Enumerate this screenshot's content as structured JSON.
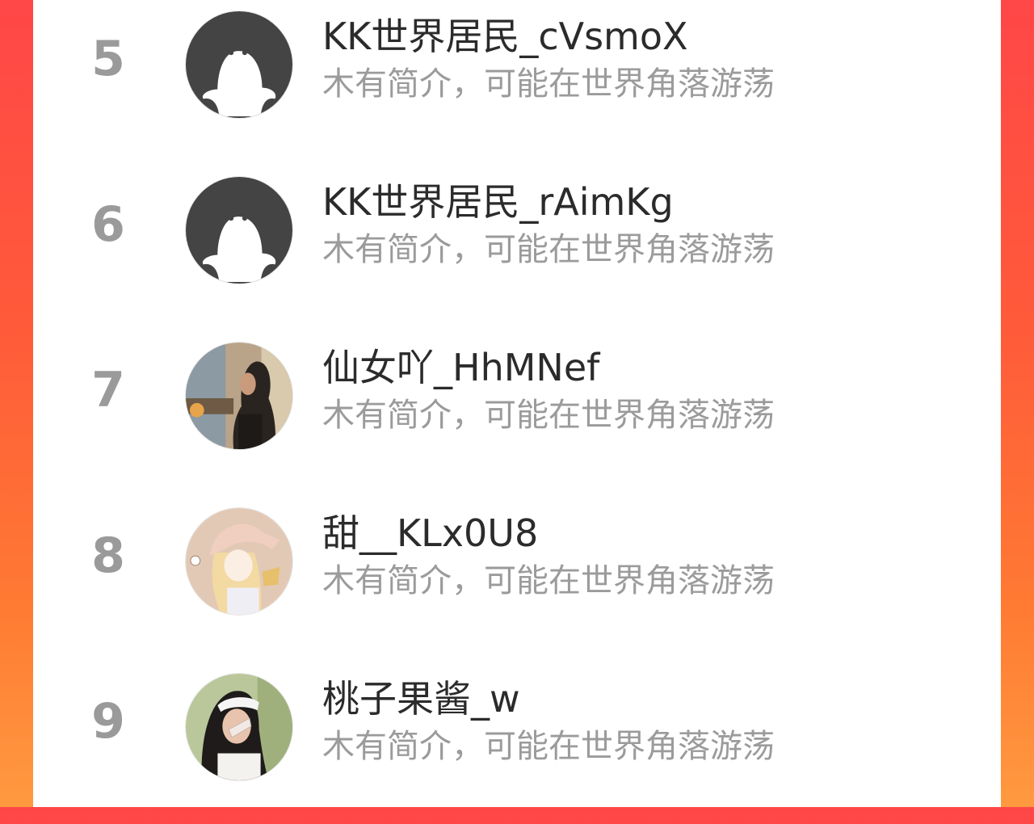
{
  "users": [
    {
      "rank": "5",
      "name": "KK世界居民_cVsmoX",
      "bio": "木有简介，可能在世界角落游荡",
      "avatar": "default-ghost-avatar"
    },
    {
      "rank": "6",
      "name": "KK世界居民_rAimKg",
      "bio": "木有简介，可能在世界角落游荡",
      "avatar": "default-ghost-avatar"
    },
    {
      "rank": "7",
      "name": "仙女吖_HhMNef",
      "bio": "木有简介，可能在世界角落游荡",
      "avatar": "photo-woman-long-hair"
    },
    {
      "rank": "8",
      "name": "甜__KLx0U8",
      "bio": "木有简介，可能在世界角落游荡",
      "avatar": "illustration-girl-nightcap"
    },
    {
      "rank": "9",
      "name": "桃子果酱_w",
      "bio": "木有简介，可能在世界角落游荡",
      "avatar": "photo-girl-hand-gesture"
    }
  ],
  "colors": {
    "background_gradient_top": "#ff4747",
    "background_gradient_bottom": "#ff9a40",
    "rank_text": "#9a9a9a",
    "name_text": "#2b2b2b",
    "bio_text": "#9b9b9b"
  }
}
